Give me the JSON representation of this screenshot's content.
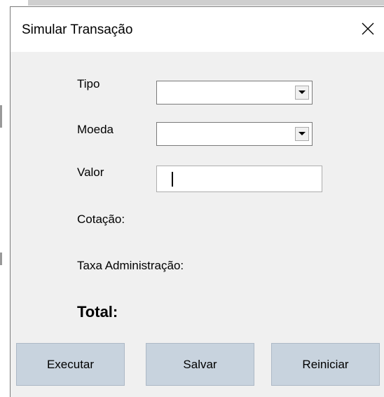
{
  "window": {
    "title": "Simular Transação"
  },
  "form": {
    "tipo_label": "Tipo",
    "tipo_value": "",
    "moeda_label": "Moeda",
    "moeda_value": "",
    "valor_label": "Valor",
    "valor_value": "",
    "cotacao_label": "Cotação:",
    "taxa_label": "Taxa Administração:",
    "total_label": "Total:"
  },
  "buttons": {
    "executar": "Executar",
    "salvar": "Salvar",
    "reiniciar": "Reiniciar"
  },
  "icons": {
    "close": "close-icon",
    "dropdown": "chevron-down-icon"
  },
  "colors": {
    "dialog_bg": "#f0f0f0",
    "button_bg": "#c8d3de",
    "titlebar_bg": "#ffffff"
  }
}
